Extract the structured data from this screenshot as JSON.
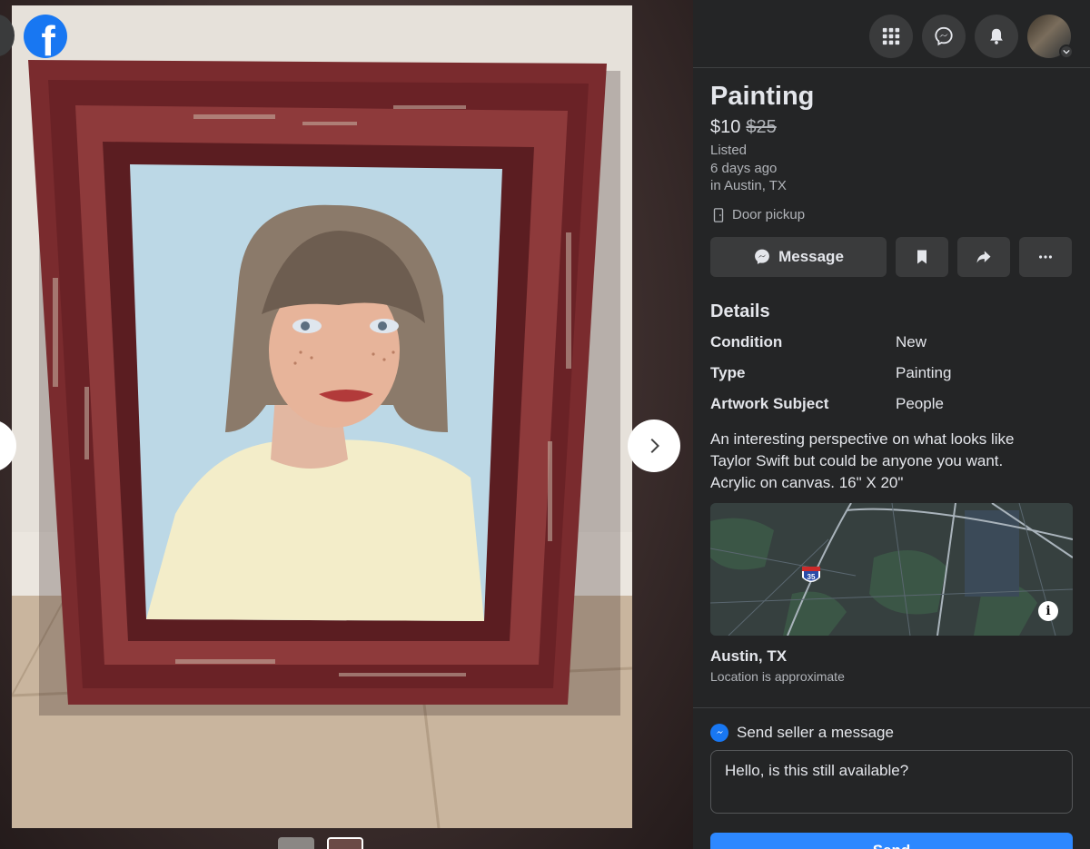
{
  "app": {
    "logo_letter": "f",
    "accent": "#1877f2"
  },
  "viewer": {
    "prev_icon": "chevron-left-icon",
    "next_icon": "chevron-right-icon",
    "thumbnails": [
      {
        "active": false
      },
      {
        "active": true
      }
    ]
  },
  "topbar": {
    "icons": [
      "menu-grid-icon",
      "messenger-icon",
      "bell-icon",
      "avatar"
    ]
  },
  "listing": {
    "title": "Painting",
    "price": "$10",
    "old_price": "$25",
    "listed_label": "Listed",
    "listed_when": "6 days ago",
    "listed_where": "in Austin, TX",
    "pickup": "Door pickup"
  },
  "actions": {
    "message_label": "Message",
    "save_icon": "bookmark-icon",
    "share_icon": "share-icon",
    "more_icon": "more-icon"
  },
  "details": {
    "heading": "Details",
    "rows": [
      {
        "key": "Condition",
        "value": "New"
      },
      {
        "key": "Type",
        "value": "Painting"
      },
      {
        "key": "Artwork Subject",
        "value": "People"
      }
    ],
    "description_lines": [
      "An interesting perspective on what looks like",
      "Taylor Swift but could be anyone you want.",
      "Acrylic on canvas. 16\" X 20\""
    ]
  },
  "map": {
    "highway_label": "35",
    "info_icon": "i"
  },
  "location": {
    "name": "Austin, TX",
    "note": "Location is approximate"
  },
  "send": {
    "heading": "Send seller a message",
    "message_text": "Hello, is this still available?",
    "button_label": "Send"
  }
}
